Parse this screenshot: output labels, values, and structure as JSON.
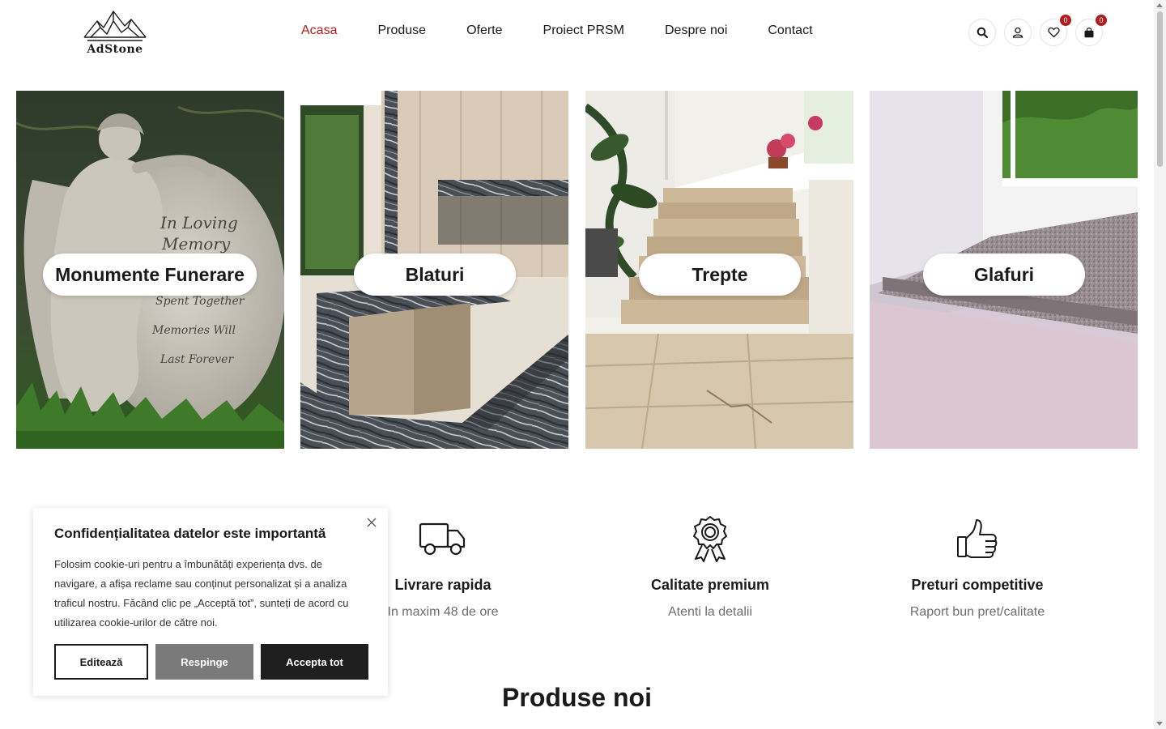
{
  "brand": {
    "name": "AdStone"
  },
  "nav": {
    "items": [
      {
        "label": "Acasa",
        "active": true
      },
      {
        "label": "Produse"
      },
      {
        "label": "Oferte"
      },
      {
        "label": "Proiect PRSM"
      },
      {
        "label": "Despre noi"
      },
      {
        "label": "Contact"
      }
    ]
  },
  "header_icons": {
    "search": "search-icon",
    "account": "user-icon",
    "wishlist": {
      "icon": "heart-icon",
      "count": "0"
    },
    "cart": {
      "icon": "bag-icon",
      "count": "0"
    }
  },
  "categories": [
    {
      "label": "Monumente Funerare"
    },
    {
      "label": "Blaturi"
    },
    {
      "label": "Trepte"
    },
    {
      "label": "Glafuri"
    }
  ],
  "angel_inscription": [
    "In Loving",
    "Memory",
    "Spent Together",
    "Memories Will",
    "Last Forever"
  ],
  "features": [
    {
      "icon": "truck-icon",
      "title": "Livrare rapida",
      "subtitle": "In maxim 48 de ore"
    },
    {
      "icon": "award-icon",
      "title": "Calitate premium",
      "subtitle": "Atenti la detalii"
    },
    {
      "icon": "thumbs-up-icon",
      "title": "Preturi competitive",
      "subtitle": "Raport bun pret/calitate"
    }
  ],
  "section": {
    "title": "Produse noi"
  },
  "cookie": {
    "title": "Confidențialitatea datelor este importantă",
    "text": "Folosim cookie-uri pentru a îmbunătăți experiența dvs. de navigare, a afișa reclame sau conținut personalizat și a analiza traficul nostru. Făcând clic pe „Acceptă tot”, sunteți de acord cu utilizarea cookie-urilor de către noi.",
    "edit_label": "Editează",
    "reject_label": "Respinge",
    "accept_label": "Accepta tot"
  },
  "colors": {
    "accent": "#b11d1d",
    "text": "#1a1a1a",
    "muted": "#6d6d6d"
  }
}
